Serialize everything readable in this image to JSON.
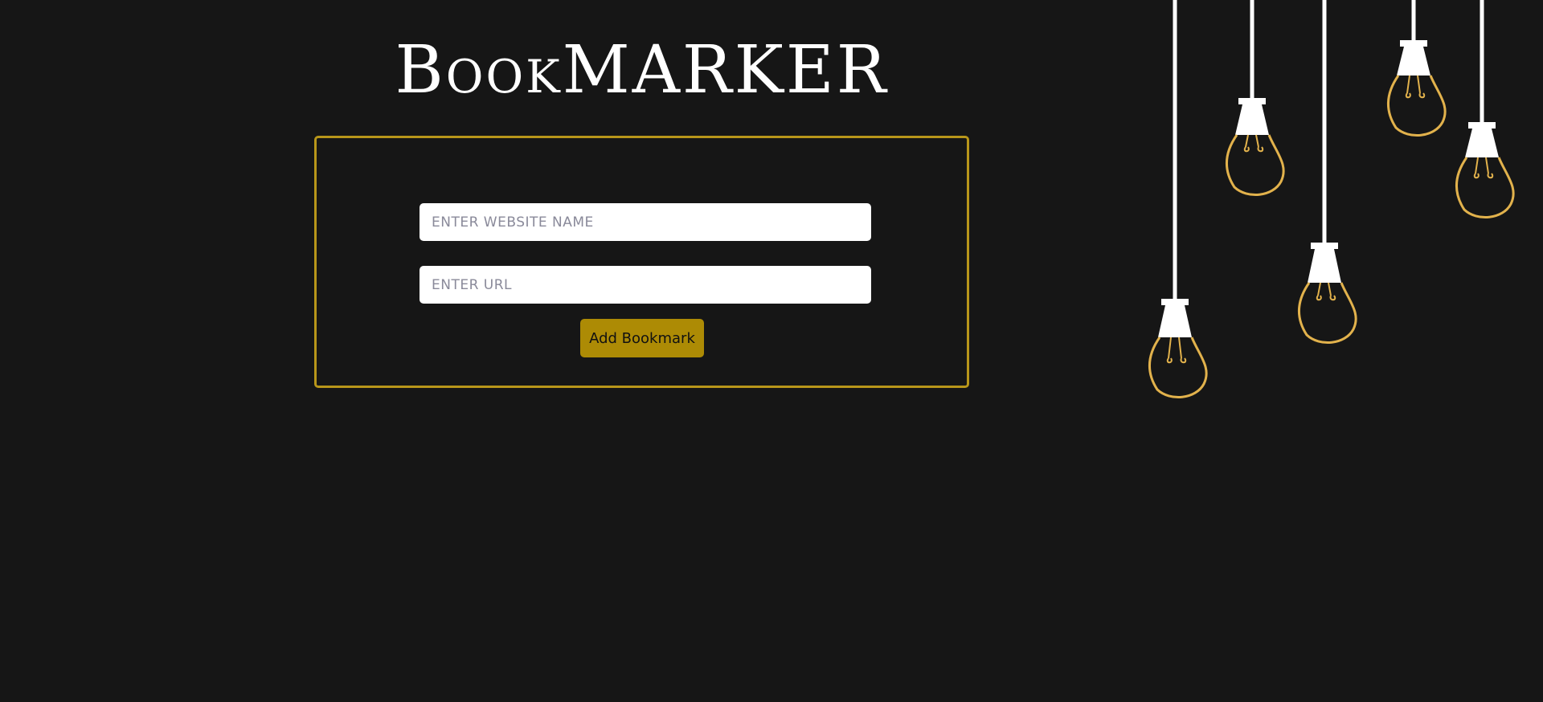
{
  "header": {
    "title": "BookMARKER"
  },
  "form": {
    "site_name_placeholder": "ENTER WEBSITE NAME",
    "site_url_placeholder": "ENTER URL",
    "submit_label": "Add Bookmark"
  },
  "colors": {
    "background": "#161616",
    "accent": "#b8961a",
    "button": "#ad8b05",
    "bulb_outline": "#e2b24c",
    "text": "#ffffff"
  },
  "decoration": {
    "icon": "hanging-light-bulbs"
  }
}
